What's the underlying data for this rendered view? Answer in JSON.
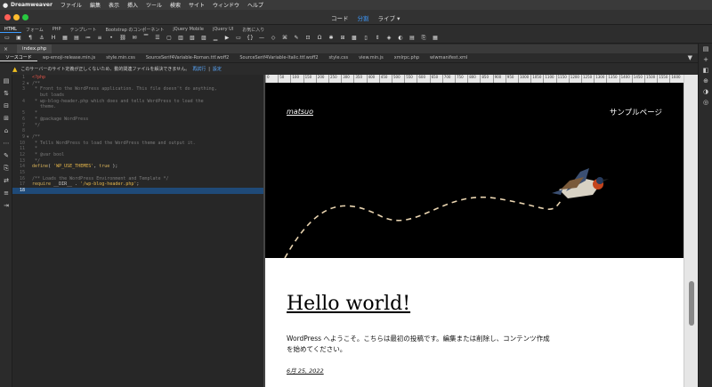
{
  "menubar": {
    "apple": "",
    "app": "Dreamweaver",
    "items": [
      "ファイル",
      "編集",
      "表示",
      "挿入",
      "ツール",
      "検索",
      "サイト",
      "ウィンドウ",
      "ヘルプ"
    ]
  },
  "viewswitch": {
    "code": "コード",
    "split": "分割",
    "live": "ライブ ▾"
  },
  "insert_tabs": [
    "HTML",
    "フォーム",
    "PHP",
    "テンプレート",
    "Bootstrap のコンポーネント",
    "jQuery Mobile",
    "jQuery UI",
    "お気に入り"
  ],
  "document_tab": "index.php",
  "related_files": [
    "ソースコード",
    "wp-emoji-release.min.js",
    "style.min.css",
    "SourceSerif4Variable-Roman.ttf.woff2",
    "SourceSerif4Variable-Italic.ttf.woff2",
    "style.css",
    "view.min.js",
    "xmlrpc.php",
    "wlwmanifest.xml"
  ],
  "warning": {
    "text": "このサーバーのサイト定義が正しくないため、動的関連ファイルを解決できません。",
    "link1": "再試行",
    "sep": "|",
    "link2": "設定"
  },
  "code_lines": [
    {
      "n": "1",
      "fold": "",
      "parts": [
        {
          "c": "k-php",
          "t": "<?php"
        }
      ]
    },
    {
      "n": "2",
      "fold": "▼",
      "parts": [
        {
          "c": "k-cm",
          "t": "/**"
        }
      ]
    },
    {
      "n": "3",
      "fold": "",
      "parts": [
        {
          "c": "k-cm",
          "t": " * Front to the WordPress application. This file doesn't do anything,"
        }
      ]
    },
    {
      "n": "",
      "fold": "",
      "parts": [
        {
          "c": "k-cm",
          "t": "   but loads"
        }
      ]
    },
    {
      "n": "4",
      "fold": "",
      "parts": [
        {
          "c": "k-cm",
          "t": " * wp-blog-header.php which does and tells WordPress to load the"
        }
      ]
    },
    {
      "n": "",
      "fold": "",
      "parts": [
        {
          "c": "k-cm",
          "t": "   theme."
        }
      ]
    },
    {
      "n": "5",
      "fold": "",
      "parts": [
        {
          "c": "k-cm",
          "t": " *"
        }
      ]
    },
    {
      "n": "6",
      "fold": "",
      "parts": [
        {
          "c": "k-cm",
          "t": " * @package WordPress"
        }
      ]
    },
    {
      "n": "7",
      "fold": "",
      "parts": [
        {
          "c": "k-cm",
          "t": " */"
        }
      ]
    },
    {
      "n": "8",
      "fold": "",
      "parts": [
        {
          "c": "k-pl",
          "t": ""
        }
      ]
    },
    {
      "n": "9",
      "fold": "▼",
      "parts": [
        {
          "c": "k-cm",
          "t": "/**"
        }
      ]
    },
    {
      "n": "10",
      "fold": "",
      "parts": [
        {
          "c": "k-cm",
          "t": " * Tells WordPress to load the WordPress theme and output it."
        }
      ]
    },
    {
      "n": "11",
      "fold": "",
      "parts": [
        {
          "c": "k-cm",
          "t": " *"
        }
      ]
    },
    {
      "n": "12",
      "fold": "",
      "parts": [
        {
          "c": "k-cm",
          "t": " * @var bool"
        }
      ]
    },
    {
      "n": "13",
      "fold": "",
      "parts": [
        {
          "c": "k-cm",
          "t": " */"
        }
      ]
    },
    {
      "n": "14",
      "fold": "",
      "parts": [
        {
          "c": "k-fn",
          "t": "define"
        },
        {
          "c": "k-pl",
          "t": "( "
        },
        {
          "c": "k-str",
          "t": "'WP_USE_THEMES'"
        },
        {
          "c": "k-pl",
          "t": ", "
        },
        {
          "c": "k-kw",
          "t": "true"
        },
        {
          "c": "k-pl",
          "t": " );"
        }
      ]
    },
    {
      "n": "15",
      "fold": "",
      "parts": [
        {
          "c": "k-pl",
          "t": ""
        }
      ]
    },
    {
      "n": "16",
      "fold": "",
      "parts": [
        {
          "c": "k-cm",
          "t": "/** Loads the WordPress Environment and Template */"
        }
      ]
    },
    {
      "n": "17",
      "fold": "",
      "parts": [
        {
          "c": "k-kw",
          "t": "require"
        },
        {
          "c": "k-pl",
          "t": " __DIR__ . "
        },
        {
          "c": "k-str",
          "t": "'/wp-blog-header.php'"
        },
        {
          "c": "k-pl",
          "t": ";"
        }
      ]
    },
    {
      "n": "18",
      "fold": "",
      "sel": true,
      "parts": [
        {
          "c": "k-pl",
          "t": ""
        }
      ]
    }
  ],
  "ruler_ticks": [
    "0",
    "50",
    "100",
    "150",
    "200",
    "250",
    "300",
    "350",
    "400",
    "450",
    "500",
    "550",
    "600",
    "650",
    "700",
    "750",
    "800",
    "850",
    "900",
    "950",
    "1000",
    "1050",
    "1100",
    "1150",
    "1200",
    "1250",
    "1300",
    "1350",
    "1400",
    "1450",
    "1500",
    "1550",
    "1600"
  ],
  "live": {
    "site_name": "matsuo",
    "nav_item": "サンプルページ",
    "post_title": "Hello world!",
    "post_body": "WordPress へようこそ。こちらは最初の投稿です。編集または削除し、コンテンツ作成を始めてください。",
    "post_date": "6月 25, 2022"
  },
  "colors": {
    "accent": "#3d9bff",
    "warning": "#f0c020",
    "hero_bg": "#000000"
  }
}
